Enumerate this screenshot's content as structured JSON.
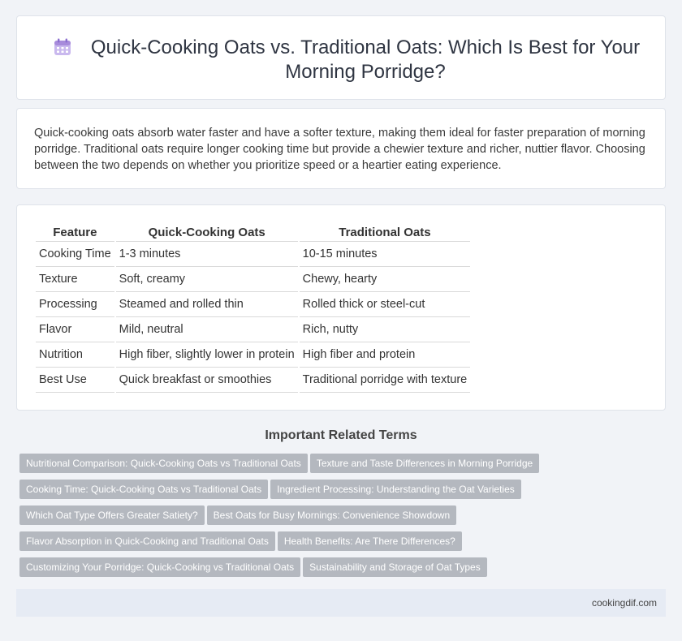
{
  "header": {
    "icon": "calendar-icon",
    "title": "Quick-Cooking Oats vs. Traditional Oats: Which Is Best for Your Morning Porridge?"
  },
  "intro": {
    "text": "Quick-cooking oats absorb water faster and have a softer texture, making them ideal for faster preparation of morning porridge. Traditional oats require longer cooking time but provide a chewier texture and richer, nuttier flavor. Choosing between the two depends on whether you prioritize speed or a heartier eating experience."
  },
  "table": {
    "headers": [
      "Feature",
      "Quick-Cooking Oats",
      "Traditional Oats"
    ],
    "rows": [
      [
        "Cooking Time",
        "1-3 minutes",
        "10-15 minutes"
      ],
      [
        "Texture",
        "Soft, creamy",
        "Chewy, hearty"
      ],
      [
        "Processing",
        "Steamed and rolled thin",
        "Rolled thick or steel-cut"
      ],
      [
        "Flavor",
        "Mild, neutral",
        "Rich, nutty"
      ],
      [
        "Nutrition",
        "High fiber, slightly lower in protein",
        "High fiber and protein"
      ],
      [
        "Best Use",
        "Quick breakfast or smoothies",
        "Traditional porridge with texture"
      ]
    ]
  },
  "related": {
    "title": "Important Related Terms",
    "rows": [
      [
        "Nutritional Comparison: Quick-Cooking Oats vs Traditional Oats",
        "Texture and Taste Differences in Morning Porridge"
      ],
      [
        "Cooking Time: Quick-Cooking Oats vs Traditional Oats",
        "Ingredient Processing: Understanding the Oat Varieties"
      ],
      [
        "Which Oat Type Offers Greater Satiety?",
        "Best Oats for Busy Mornings: Convenience Showdown"
      ],
      [
        "Flavor Absorption in Quick-Cooking and Traditional Oats",
        "Health Benefits: Are There Differences?"
      ],
      [
        "Customizing Your Porridge: Quick-Cooking vs Traditional Oats",
        "Sustainability and Storage of Oat Types"
      ]
    ]
  },
  "footer": {
    "site": "cookingdif.com"
  },
  "colors": {
    "background": "#f1f3f7",
    "tag_background": "#b4b8bf",
    "footer_background": "#e6ebf4",
    "icon_accent": "#a78bdb"
  }
}
